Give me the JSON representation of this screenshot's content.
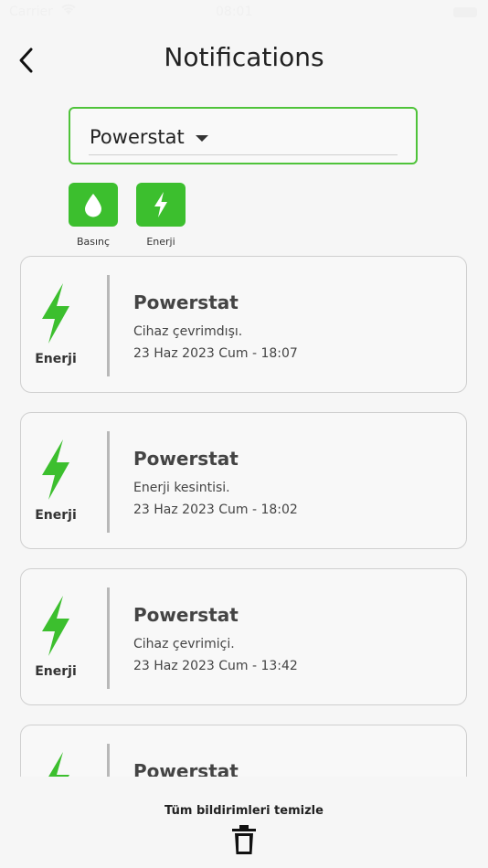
{
  "status_bar": {
    "carrier": "Carrier",
    "time": "08:01"
  },
  "header": {
    "title": "Notifications"
  },
  "device_select": {
    "value": "Powerstat"
  },
  "filters": [
    {
      "label": "Basınç",
      "icon": "water-drop-icon"
    },
    {
      "label": "Enerji",
      "icon": "lightning-icon"
    }
  ],
  "notifications": [
    {
      "type": "Enerji",
      "icon": "lightning-icon",
      "title": "Powerstat",
      "message": "Cihaz çevrimdışı.",
      "date": "23 Haz 2023 Cum - 18:07"
    },
    {
      "type": "Enerji",
      "icon": "lightning-icon",
      "title": "Powerstat",
      "message": "Enerji kesintisi.",
      "date": "23 Haz 2023 Cum - 18:02"
    },
    {
      "type": "Enerji",
      "icon": "lightning-icon",
      "title": "Powerstat",
      "message": "Cihaz çevrimiçi.",
      "date": "23 Haz 2023 Cum - 13:42"
    },
    {
      "type": "Enerji",
      "icon": "lightning-icon",
      "title": "Powerstat",
      "message": "",
      "date": ""
    }
  ],
  "footer": {
    "clear_all_label": "Tüm bildirimleri temizle"
  },
  "colors": {
    "accent": "#3cbf2e",
    "border": "#4fc33a",
    "background": "#f6f6f6"
  }
}
